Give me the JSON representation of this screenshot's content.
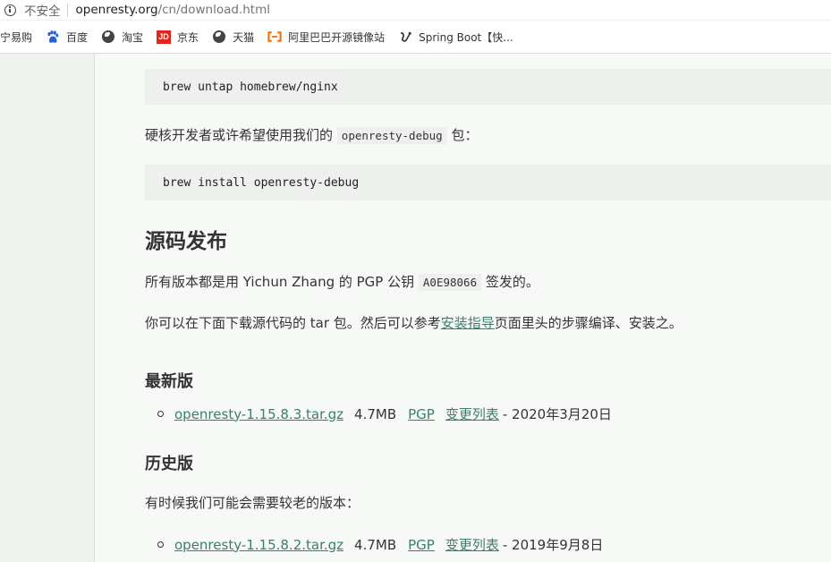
{
  "addressbar": {
    "security_label": "不安全",
    "url_host": "openresty.org",
    "url_path": "/cn/download.html"
  },
  "bookmarks": [
    {
      "label": "宁易购",
      "icon": "none"
    },
    {
      "label": "百度",
      "icon": "baidu-paw-icon"
    },
    {
      "label": "淘宝",
      "icon": "globe-icon"
    },
    {
      "label": "京东",
      "icon": "jd-icon"
    },
    {
      "label": "天猫",
      "icon": "globe-icon"
    },
    {
      "label": "阿里巴巴开源镜像站",
      "icon": "aliyun-icon"
    },
    {
      "label": "Spring Boot【快...",
      "icon": "spring-icon"
    }
  ],
  "content": {
    "code1": "brew untap homebrew/nginx",
    "para1_before": "硬核开发者或许希望使用我们的",
    "para1_code": "openresty-debug",
    "para1_after": "包：",
    "code2": "brew install openresty-debug",
    "heading_source": "源码发布",
    "para2_before": "所有版本都是用 Yichun Zhang 的 PGP 公钥",
    "para2_code": "A0E98066",
    "para2_after": "签发的。",
    "para3_before": "你可以在下面下载源代码的 tar 包。然后可以参考",
    "para3_link": "安装指导",
    "para3_after": "页面里头的步骤编译、安装之。",
    "heading_latest": "最新版",
    "latest": {
      "file": "openresty-1.15.8.3.tar.gz",
      "size": "4.7MB",
      "pgp": "PGP",
      "changes": "变更列表",
      "date": "- 2020年3月20日"
    },
    "heading_history": "历史版",
    "para4": "有时候我们可能会需要较老的版本：",
    "older": {
      "file": "openresty-1.15.8.2.tar.gz",
      "size": "4.7MB",
      "pgp": "PGP",
      "changes": "变更列表",
      "date": "- 2019年9月8日"
    }
  },
  "colors": {
    "link": "#3d7d6c",
    "code_bg": "#edf0ed",
    "sidebar_bg": "#eef3ee"
  }
}
